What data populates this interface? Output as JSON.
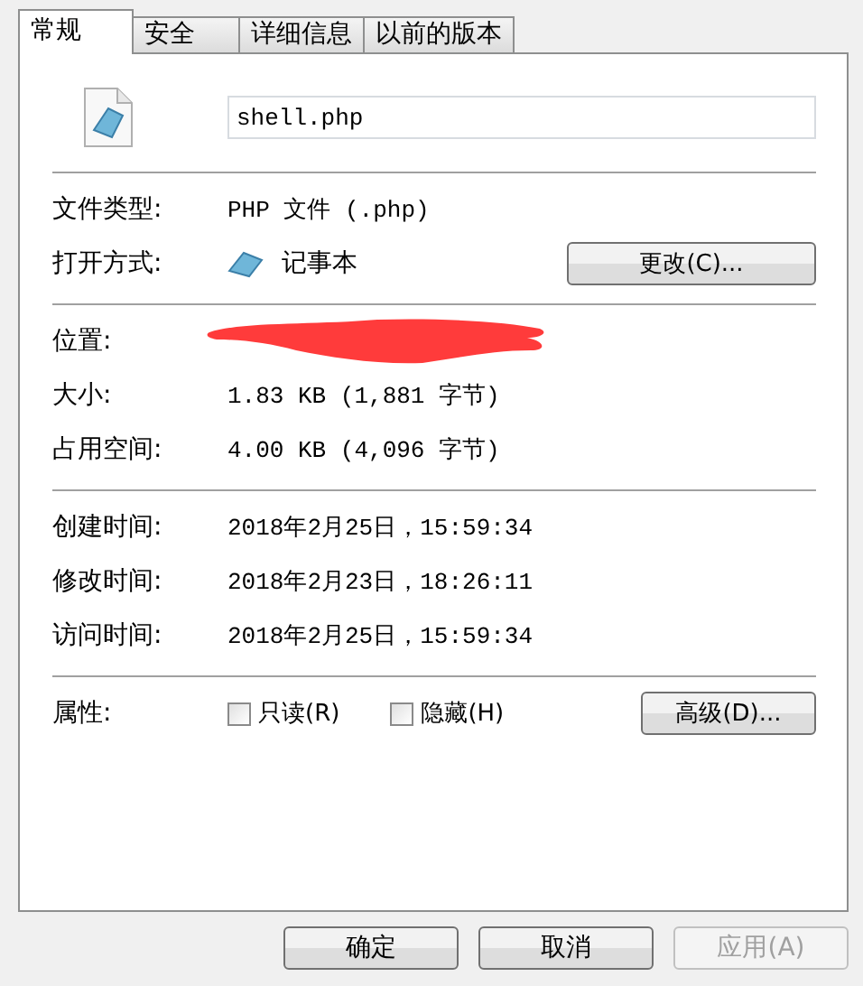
{
  "tabs": [
    {
      "label": "常规",
      "selected": true
    },
    {
      "label": "安全",
      "selected": false
    },
    {
      "label": "详细信息",
      "selected": false
    },
    {
      "label": "以前的版本",
      "selected": false
    }
  ],
  "file_name": "shell.php",
  "file_type": {
    "label": "文件类型:",
    "value": "PHP 文件 (.php)"
  },
  "opens_with": {
    "label": "打开方式:",
    "app": "记事本",
    "button": "更改(C)..."
  },
  "location": {
    "label": "位置:",
    "redacted": true
  },
  "sizes": [
    {
      "label": "大小:",
      "value": "1.83 KB (1,881 字节)"
    },
    {
      "label": "占用空间:",
      "value": "4.00 KB (4,096 字节)"
    }
  ],
  "times": [
    {
      "label": "创建时间:",
      "value": "2018年2月25日，15:59:34"
    },
    {
      "label": "修改时间:",
      "value": "2018年2月23日，18:26:11"
    },
    {
      "label": "访问时间:",
      "value": "2018年2月25日，15:59:34"
    }
  ],
  "attributes": {
    "label": "属性:",
    "options": [
      {
        "label": "只读(R)",
        "checked": false
      },
      {
        "label": "隐藏(H)",
        "checked": false
      }
    ],
    "button": "高级(D)..."
  },
  "buttons": [
    {
      "label": "确定",
      "disabled": false
    },
    {
      "label": "取消",
      "disabled": false
    },
    {
      "label": "应用(A)",
      "disabled": true
    }
  ]
}
